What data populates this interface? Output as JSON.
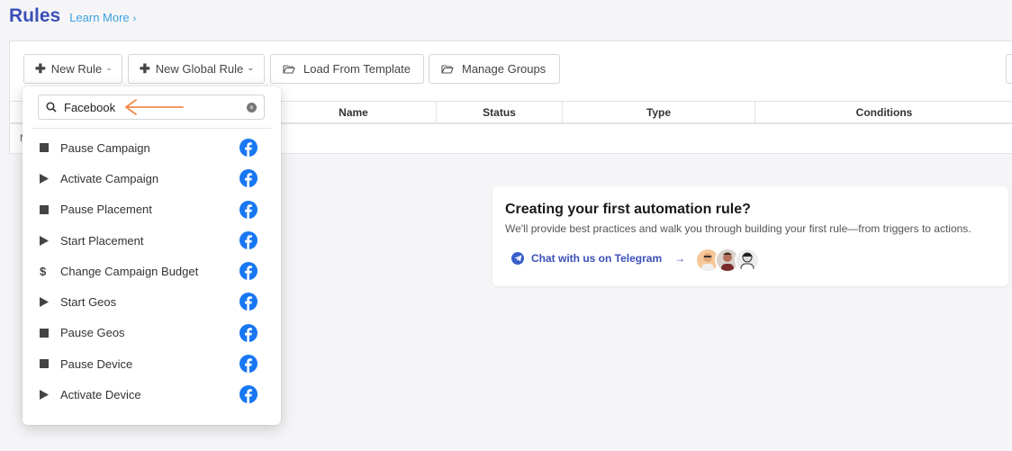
{
  "header": {
    "title": "Rules",
    "learn_more": "Learn More",
    "learn_more_chevron": "›"
  },
  "toolbar": {
    "new_rule": "New Rule",
    "new_global_rule": "New Global Rule",
    "load_from_template": "Load From Template",
    "manage_groups": "Manage Groups"
  },
  "table": {
    "columns": [
      "Name",
      "Status",
      "Type",
      "Conditions"
    ],
    "row_stub": "N"
  },
  "dropdown": {
    "search_value": "Facebook",
    "clear_glyph": "×",
    "items": [
      {
        "label": "Pause Campaign",
        "icon": "stop"
      },
      {
        "label": "Activate Campaign",
        "icon": "play"
      },
      {
        "label": "Pause Placement",
        "icon": "stop"
      },
      {
        "label": "Start Placement",
        "icon": "play"
      },
      {
        "label": "Change Campaign Budget",
        "icon": "dollar"
      },
      {
        "label": "Start Geos",
        "icon": "play"
      },
      {
        "label": "Pause Geos",
        "icon": "stop"
      },
      {
        "label": "Pause Device",
        "icon": "stop"
      },
      {
        "label": "Activate Device",
        "icon": "play"
      }
    ],
    "platform_icon": "facebook-icon",
    "annotation_color": "#f08a4b"
  },
  "card": {
    "title": "Creating your first automation rule?",
    "description": "We'll provide best practices and walk you through building your first rule—from triggers to actions.",
    "link_label": "Chat with us on Telegram",
    "link_arrow": "→"
  },
  "colors": {
    "brand": "#3b4fb8",
    "link": "#3aa0e0",
    "facebook": "#1877f2"
  }
}
